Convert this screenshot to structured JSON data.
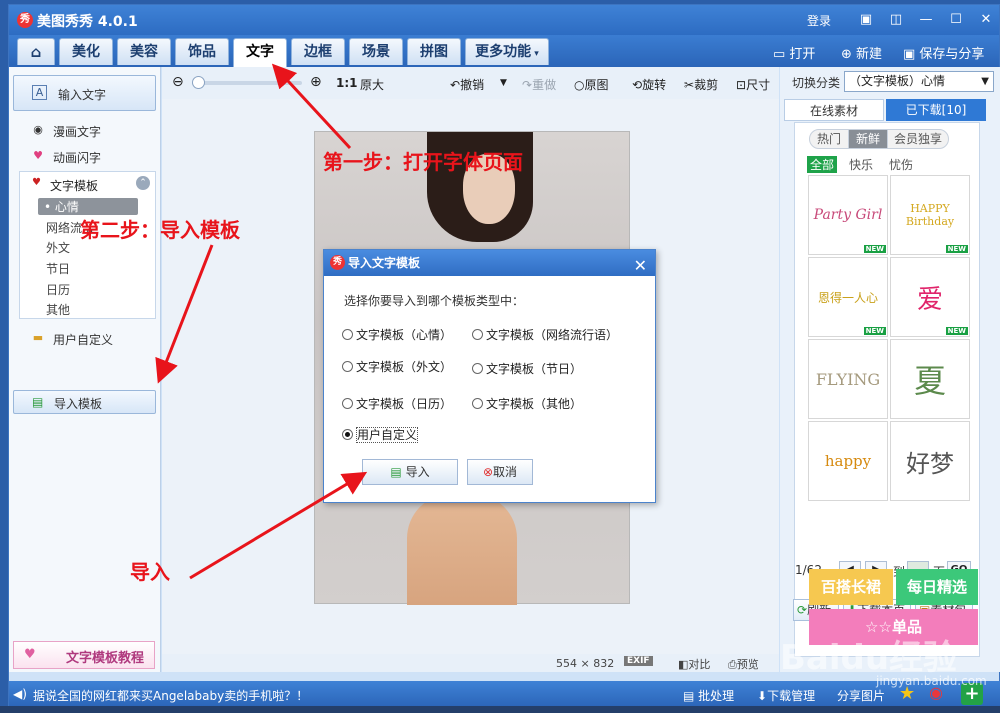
{
  "app": {
    "title": "美图秀秀 4.0.1",
    "logo": "秀",
    "login": "登录"
  },
  "tabs": [
    "美化",
    "美容",
    "饰品",
    "文字",
    "边框",
    "场景",
    "拼图",
    "更多功能"
  ],
  "active_tab": "文字",
  "file_actions": {
    "open": "打开",
    "new": "新建",
    "save": "保存与分享"
  },
  "left_panel": {
    "input_text": "输入文字",
    "comic_text": "漫画文字",
    "animated_text": "动画闪字",
    "text_template": "文字模板",
    "sub_items": [
      "心情",
      "网络流...",
      "外文",
      "节日",
      "日历",
      "其他"
    ],
    "custom": "用户自定义",
    "import_template": "导入模板",
    "tutorial": "文字模板教程"
  },
  "toolbar": {
    "ratio": "1:1",
    "original_size": "原大",
    "undo": "撤销",
    "redo": "重做",
    "original": "原图",
    "rotate": "旋转",
    "crop": "裁剪",
    "size": "尺寸"
  },
  "right_panel": {
    "switch_label": "切换分类",
    "category": "（文字模板）心情",
    "tab_online": "在线素材",
    "tab_downloaded": "已下载[10]",
    "pills": [
      "热门",
      "新鲜",
      "会员独享"
    ],
    "filters": [
      "全部",
      "快乐",
      "忧伤"
    ],
    "thumbs": [
      "Party Girl",
      "HAPPY Birthday",
      "恩得一人心",
      "爱",
      "FLYING",
      "夏",
      "happy",
      "好梦"
    ],
    "new_badge": "NEW",
    "page_info": "1/62",
    "goto": "到",
    "page_unit": "页",
    "go": "GO",
    "refresh": "刷新",
    "download_page": "下载本页",
    "library": "素材包",
    "banner1": "百搭长裙",
    "banner2": "每日精选",
    "banner3": "☆☆单品"
  },
  "status": {
    "dims": "554 × 832",
    "exif": "EXIF",
    "compare": "对比",
    "preview": "预览"
  },
  "dialog": {
    "title": "导入文字模板",
    "prompt": "选择你要导入到哪个模板类型中：",
    "options": [
      "文字模板（心情）",
      "文字模板（网络流行语）",
      "文字模板（外文）",
      "文字模板（节日）",
      "文字模板（日历）",
      "文字模板（其他）",
      "用户自定义"
    ],
    "selected": "用户自定义",
    "import_btn": "导入",
    "cancel_btn": "取消"
  },
  "bottom_bar": {
    "news": "据说全国的网红都来买Angelababy卖的手机啦？！",
    "batch": "批处理",
    "download_mgr": "下载管理",
    "share_pic": "分享图片"
  },
  "annotations": {
    "step1": "第一步：打开字体页面",
    "step2": "第二步：导入模板",
    "step3": "导入"
  },
  "watermark": {
    "main": "Baidu经验",
    "sub": "jingyan.baidu.com"
  }
}
